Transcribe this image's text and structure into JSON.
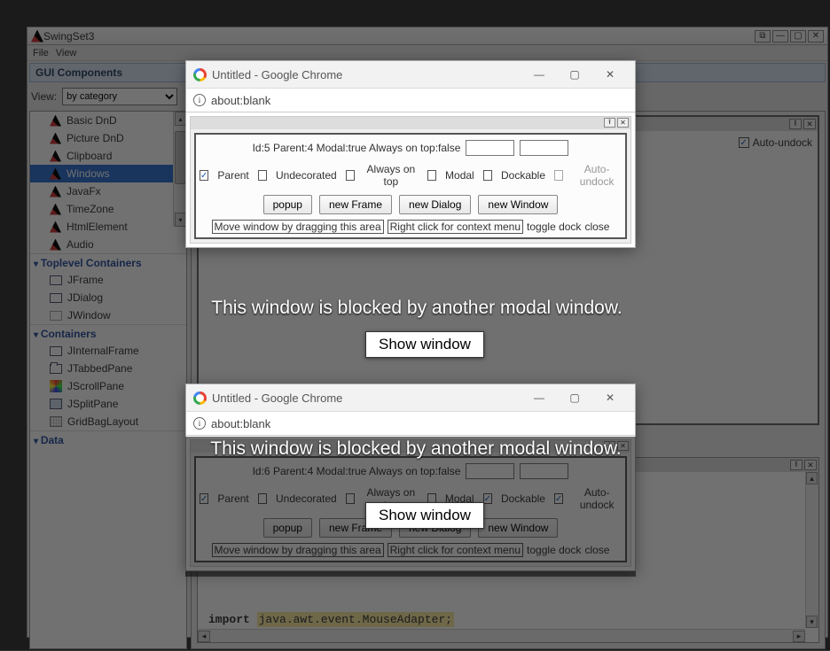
{
  "main_window": {
    "title": "SwingSet3",
    "menu": [
      "File",
      "View"
    ],
    "wbtns": {
      "undock": "⧉",
      "min": "—",
      "max": "▢",
      "close": "✕"
    }
  },
  "sidebar": {
    "header": "GUI Components",
    "view_label": "View:",
    "view_value": "by category",
    "group_basic_items": [
      "Basic DnD",
      "Picture DnD",
      "Clipboard",
      "Windows",
      "JavaFx",
      "TimeZone",
      "HtmlElement",
      "Audio"
    ],
    "group_toplevel": {
      "title": "Toplevel Containers",
      "items": [
        "JFrame",
        "JDialog",
        "JWindow"
      ]
    },
    "group_containers": {
      "title": "Containers",
      "items": [
        "JInternalFrame",
        "JTabbedPane",
        "JScrollPane",
        "JSplitPane",
        "GridBagLayout"
      ]
    },
    "group_data": {
      "title": "Data"
    }
  },
  "content": {
    "auto_undock": "Auto-undock",
    "code_kw": "import",
    "code_rest": "java.awt.event.MouseAdapter;"
  },
  "chrome": {
    "title": "Untitled - Google Chrome",
    "url": "about:blank",
    "wbtns": {
      "min": "—",
      "max": "▢",
      "close": "✕"
    }
  },
  "panel": {
    "info": "Id:5  Parent:4  Modal:true  Always on top:false",
    "info2": "Id:6  Parent:4  Modal:true  Always on top:false",
    "checks": [
      "Parent",
      "Undecorated",
      "Always on top",
      "Modal",
      "Dockable",
      "Auto-undock"
    ],
    "check_states_top": [
      true,
      false,
      false,
      false,
      false,
      false
    ],
    "check_states_bot": [
      true,
      false,
      false,
      false,
      true,
      true
    ],
    "buttons": [
      "popup",
      "new Frame",
      "new Dialog",
      "new Window"
    ],
    "hint1": "Move window by dragging this area",
    "hint2": "Right click for context menu",
    "hint3": "toggle dock",
    "hint4": "close"
  },
  "overlay": {
    "msg": "This window is blocked by another modal window.",
    "btn": "Show window"
  }
}
